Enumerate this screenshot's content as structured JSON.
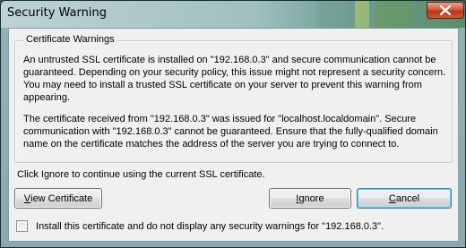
{
  "window": {
    "title": "Security Warning"
  },
  "group": {
    "legend": "Certificate Warnings",
    "paragraph1": "An untrusted SSL certificate is installed on \"192.168.0.3\" and secure communication cannot be guaranteed.  Depending on your security policy, this issue might not represent a security concern.  You may need to install a trusted SSL certificate on your server to prevent this warning from appearing.",
    "paragraph2": "The certificate received from \"192.168.0.3\" was issued for \"localhost.localdomain\".  Secure communication with \"192.168.0.3\" cannot be guaranteed.  Ensure that the fully-qualified domain name on the certificate matches the address of the server you are trying to connect to."
  },
  "instruction": "Click Ignore to continue using the current SSL certificate.",
  "buttons": {
    "view_certificate": {
      "mnemonic": "V",
      "rest": "iew Certificate"
    },
    "ignore": {
      "mnemonic": "I",
      "rest": "gnore"
    },
    "cancel": {
      "mnemonic": "C",
      "rest": "ancel"
    }
  },
  "checkbox": {
    "checked": false,
    "label_mnemonic": "I",
    "label_rest": "nstall this certificate and do not display any security warnings for \"192.168.0.3\"."
  },
  "icons": {
    "close": "close-icon"
  },
  "colors": {
    "close_button": "#c94a2e",
    "default_button_border": "#3c7fb1"
  }
}
